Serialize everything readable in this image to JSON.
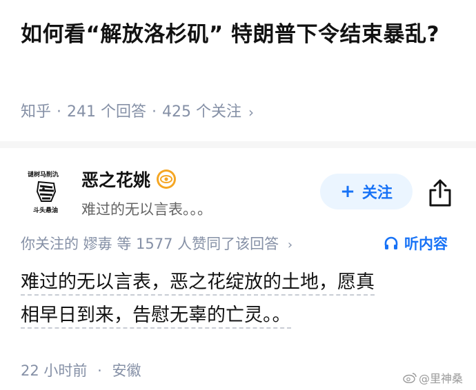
{
  "question": {
    "title": "如何看“解放洛杉矶” 特朗普下令结束暴乱?",
    "source": "知乎",
    "answer_count": "241 个回答",
    "follower_count": "425 个关注",
    "chevron": "›"
  },
  "author": {
    "name": "恶之花姚",
    "bio": "难过的无以言表。。。",
    "avatar_top_text": "谜树马削氿",
    "avatar_bottom_text": "斗头悬油",
    "badge_icon": "eye-badge-icon",
    "badge_color": "#f5a623"
  },
  "actions": {
    "follow_plus": "+",
    "follow_label": "关注",
    "share_icon": "share-icon"
  },
  "answer": {
    "voters_text": "你关注的 嫪毐 等 1577 人赞同了该回答",
    "voters_chevron": "›",
    "listen_label": "听内容",
    "listen_icon": "headphones-icon",
    "content_line1": "难过的无以言表，恶之花绽放的土地，愿真",
    "content_line2": "相早日到来，告慰无辜的亡灵。。",
    "time": "22 小时前",
    "location": "安徽"
  },
  "watermark": {
    "text": "@里神桑",
    "icon": "weibo-icon"
  },
  "colors": {
    "accent": "#1772f6",
    "meta_gray": "#8590a6",
    "follow_bg": "#ebf5ff",
    "divider": "#f6f6f6"
  }
}
